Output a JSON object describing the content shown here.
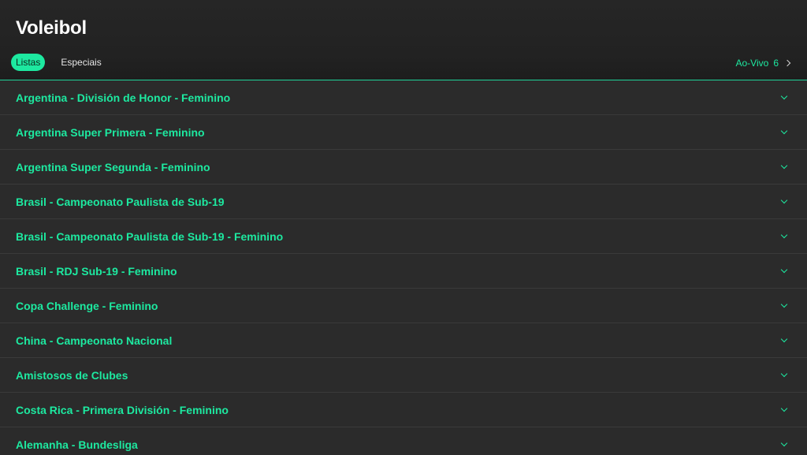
{
  "header": {
    "title": "Voleibol",
    "tabs": [
      {
        "label": "Listas",
        "active": true
      },
      {
        "label": "Especiais",
        "active": false
      }
    ],
    "live": {
      "label": "Ao-Vivo",
      "count": "6"
    }
  },
  "competitions": [
    {
      "label": "Argentina - División de Honor - Feminino"
    },
    {
      "label": "Argentina Super Primera - Feminino"
    },
    {
      "label": "Argentina Super Segunda - Feminino"
    },
    {
      "label": "Brasil - Campeonato Paulista de Sub-19"
    },
    {
      "label": "Brasil - Campeonato Paulista de Sub-19 - Feminino"
    },
    {
      "label": "Brasil - RDJ Sub-19 - Feminino"
    },
    {
      "label": "Copa Challenge - Feminino"
    },
    {
      "label": "China - Campeonato Nacional"
    },
    {
      "label": "Amistosos de Clubes"
    },
    {
      "label": "Costa Rica - Primera División - Feminino"
    },
    {
      "label": "Alemanha - Bundesliga"
    }
  ],
  "colors": {
    "accent": "#1de9a0",
    "background": "#2b2b2b",
    "header": "#222222"
  },
  "icons": {
    "row_expand": "chevron-down-icon",
    "live_arrow": "chevron-right-icon"
  }
}
